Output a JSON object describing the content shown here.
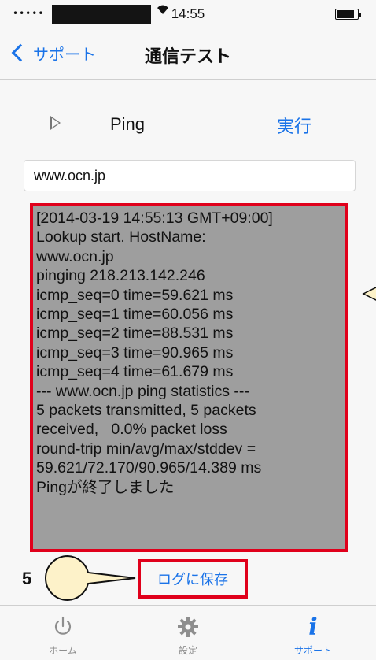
{
  "status_bar": {
    "signal": "•••••",
    "time": "14:55"
  },
  "nav": {
    "back_label": "サポート",
    "title": "通信テスト"
  },
  "ping": {
    "label": "Ping",
    "run_label": "実行"
  },
  "host_input": {
    "value": "www.ocn.jp"
  },
  "log": {
    "lines": [
      "[2014-03-19 14:55:13 GMT+09:00]",
      "Lookup start. HostName:",
      "www.ocn.jp",
      "pinging 218.213.142.246",
      "icmp_seq=0 time=59.621 ms",
      "icmp_seq=1 time=60.056 ms",
      "icmp_seq=2 time=88.531 ms",
      "icmp_seq=3 time=90.965 ms",
      "icmp_seq=4 time=61.679 ms",
      "--- www.ocn.jp ping statistics ---",
      "5 packets transmitted, 5 packets",
      "received,   0.0% packet loss",
      "round-trip min/avg/max/stddev =",
      "59.621/72.170/90.965/14.389 ms",
      "Pingが終了しました"
    ]
  },
  "save": {
    "label": "ログに保存"
  },
  "callout": {
    "step": "5"
  },
  "tabs": [
    {
      "label": "ホーム",
      "icon": "power-icon",
      "active": false
    },
    {
      "label": "設定",
      "icon": "gear-icon",
      "active": false
    },
    {
      "label": "サポート",
      "icon": "info-icon",
      "active": true
    }
  ],
  "colors": {
    "accent": "#1a73e8",
    "highlight_red": "#e0001b",
    "log_background": "#9e9e9e",
    "callout_fill": "#fdf2c9"
  }
}
